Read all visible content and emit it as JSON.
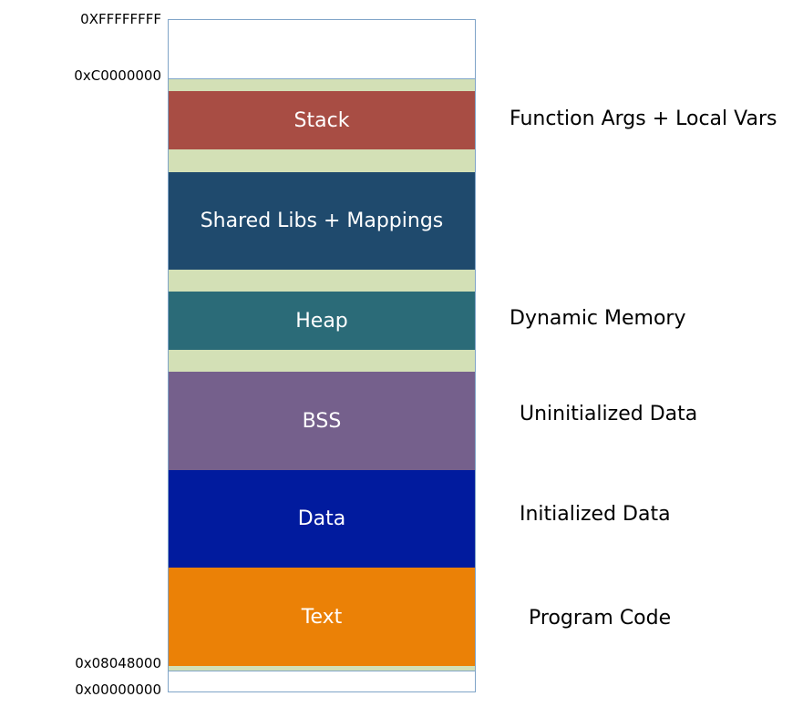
{
  "addresses": {
    "top": "0XFFFFFFFF",
    "kernel_base": "0xC0000000",
    "text_start": "0x08048000",
    "bottom": "0x00000000"
  },
  "segments": {
    "stack": "Stack",
    "shared_libs": "Shared Libs + Mappings",
    "heap": "Heap",
    "bss": "BSS",
    "data": "Data",
    "text": "Text"
  },
  "descriptions": {
    "stack": "Function Args + Local Vars",
    "heap": "Dynamic Memory",
    "bss": "Uninitialized Data",
    "data": "Initialized Data",
    "text": "Program Code"
  },
  "colors": {
    "stack": "#a84d44",
    "shared_libs": "#1f4a6d",
    "heap": "#2b6b78",
    "bss": "#75608c",
    "data": "#011b9e",
    "text": "#eb8106",
    "gap": "#d3e0b6"
  }
}
